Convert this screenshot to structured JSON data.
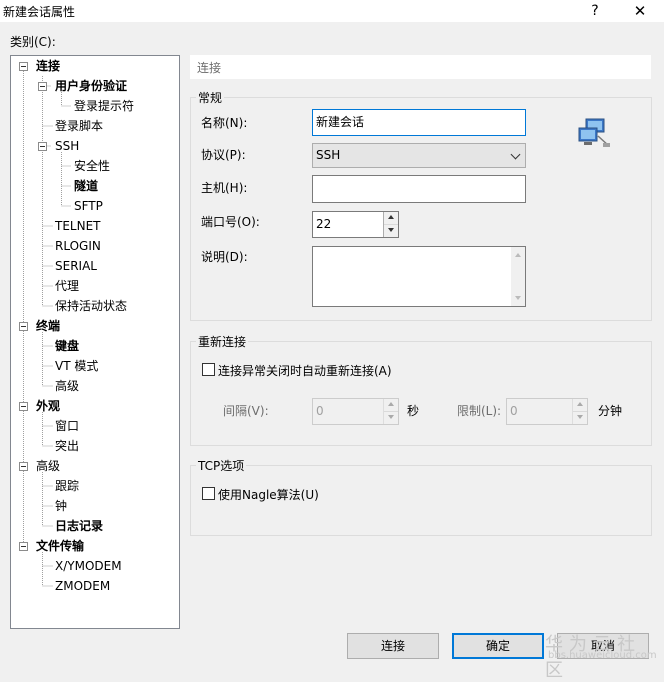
{
  "window": {
    "title": "新建会话属性",
    "help": "?",
    "close": "✕"
  },
  "category_label": "类别(C):",
  "tree": [
    {
      "label": "连接",
      "bold": true
    },
    {
      "label": "用户身份验证",
      "bold": true
    },
    {
      "label": "登录提示符",
      "bold": false
    },
    {
      "label": "登录脚本",
      "bold": false
    },
    {
      "label": "SSH",
      "bold": false
    },
    {
      "label": "安全性",
      "bold": false
    },
    {
      "label": "隧道",
      "bold": true
    },
    {
      "label": "SFTP",
      "bold": false
    },
    {
      "label": "TELNET",
      "bold": false
    },
    {
      "label": "RLOGIN",
      "bold": false
    },
    {
      "label": "SERIAL",
      "bold": false
    },
    {
      "label": "代理",
      "bold": false
    },
    {
      "label": "保持活动状态",
      "bold": false
    },
    {
      "label": "终端",
      "bold": true
    },
    {
      "label": "键盘",
      "bold": true
    },
    {
      "label": "VT 模式",
      "bold": false
    },
    {
      "label": "高级",
      "bold": false
    },
    {
      "label": "外观",
      "bold": true
    },
    {
      "label": "窗口",
      "bold": false
    },
    {
      "label": "突出",
      "bold": false
    },
    {
      "label": "高级",
      "bold": false
    },
    {
      "label": "跟踪",
      "bold": false
    },
    {
      "label": "钟",
      "bold": false
    },
    {
      "label": "日志记录",
      "bold": true
    },
    {
      "label": "文件传输",
      "bold": true
    },
    {
      "label": "X/YMODEM",
      "bold": false
    },
    {
      "label": "ZMODEM",
      "bold": false
    }
  ],
  "panel_title": "连接",
  "general": {
    "title": "常规",
    "name_label": "名称(N):",
    "name_value": "新建会话",
    "protocol_label": "协议(P):",
    "protocol_value": "SSH",
    "host_label": "主机(H):",
    "host_value": "",
    "port_label": "端口号(O):",
    "port_value": "22",
    "desc_label": "说明(D):",
    "desc_value": ""
  },
  "reconnect": {
    "title": "重新连接",
    "checkbox_label": "连接异常关闭时自动重新连接(A)",
    "interval_label": "间隔(V):",
    "interval_value": "0",
    "interval_unit": "秒",
    "limit_label": "限制(L):",
    "limit_value": "0",
    "limit_unit": "分钟"
  },
  "tcp": {
    "title": "TCP选项",
    "checkbox_label": "使用Nagle算法(U)"
  },
  "buttons": {
    "connect": "连接",
    "ok": "确定",
    "cancel": "取消"
  },
  "watermark": {
    "main": "华为云社区",
    "sub": "bbs.huaweicloud.com"
  }
}
